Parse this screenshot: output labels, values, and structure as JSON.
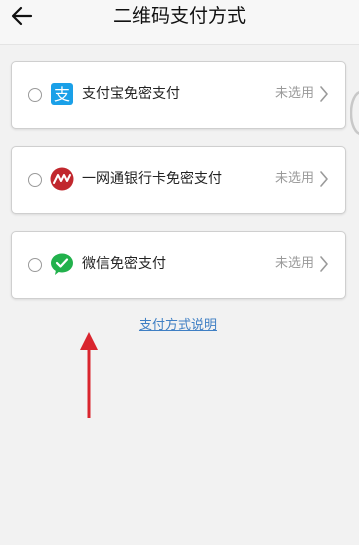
{
  "header": {
    "title": "二维码支付方式",
    "back_icon": "arrow-left-icon"
  },
  "payment_methods": [
    {
      "label": "支付宝免密支付",
      "status": "未选用",
      "icon": "alipay-logo",
      "icon_color": "#1aa0e8"
    },
    {
      "label": "一网通银行卡免密支付",
      "status": "未选用",
      "icon": "yiwangtong-logo",
      "icon_color": "#c1272d"
    },
    {
      "label": "微信免密支付",
      "status": "未选用",
      "icon": "wechat-logo",
      "icon_color": "#22b14c"
    }
  ],
  "help_link": {
    "text": "支付方式说明"
  },
  "colors": {
    "background": "#f2f2f2",
    "link": "#3f7fc4",
    "annotation_arrow": "#d9252e",
    "muted_text": "#9a9a9a"
  }
}
